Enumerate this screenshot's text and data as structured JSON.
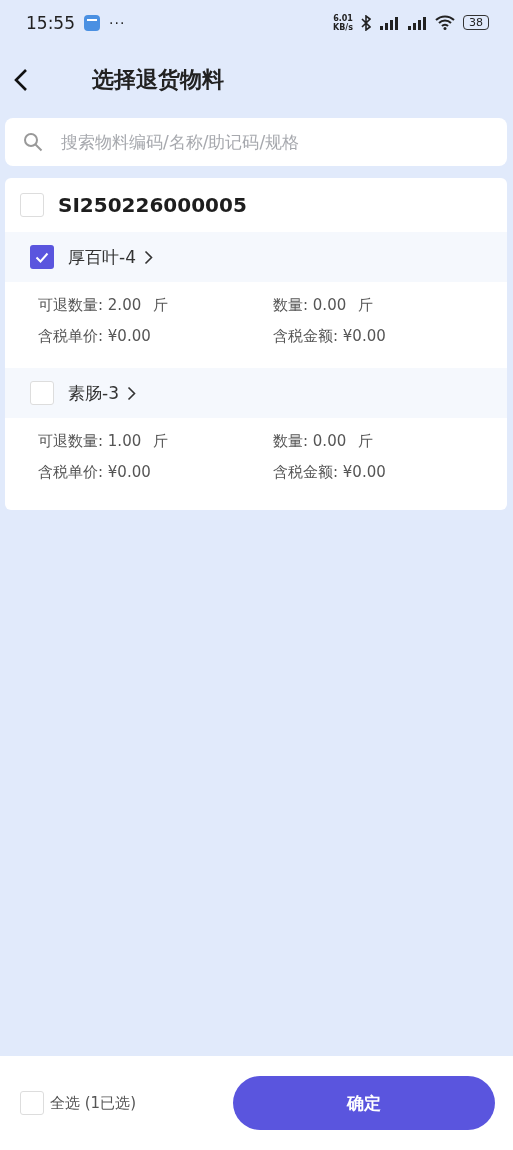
{
  "status_bar": {
    "time": "15:55",
    "more": "···",
    "speed_value": "6.01",
    "speed_unit": "KB/s",
    "battery": "38"
  },
  "header": {
    "title": "选择退货物料"
  },
  "search": {
    "placeholder": "搜索物料编码/名称/助记码/规格"
  },
  "order": {
    "number": "SI250226000005",
    "checked": false,
    "items": [
      {
        "name": "厚百叶-4",
        "checked": true,
        "fields": [
          {
            "text": "可退数量: 2.00",
            "unit": "斤"
          },
          {
            "text": "数量: 0.00",
            "unit": "斤"
          },
          {
            "text": "含税单价: ¥0.00"
          },
          {
            "text": "含税金额: ¥0.00"
          }
        ]
      },
      {
        "name": "素肠-3",
        "checked": false,
        "fields": [
          {
            "text": "可退数量: 1.00",
            "unit": "斤"
          },
          {
            "text": "数量: 0.00",
            "unit": "斤"
          },
          {
            "text": "含税单价: ¥0.00"
          },
          {
            "text": "含税金额: ¥0.00"
          }
        ]
      }
    ]
  },
  "footer": {
    "select_all": {
      "label": "全选 (1已选)",
      "checked": false
    },
    "confirm": "确定"
  }
}
